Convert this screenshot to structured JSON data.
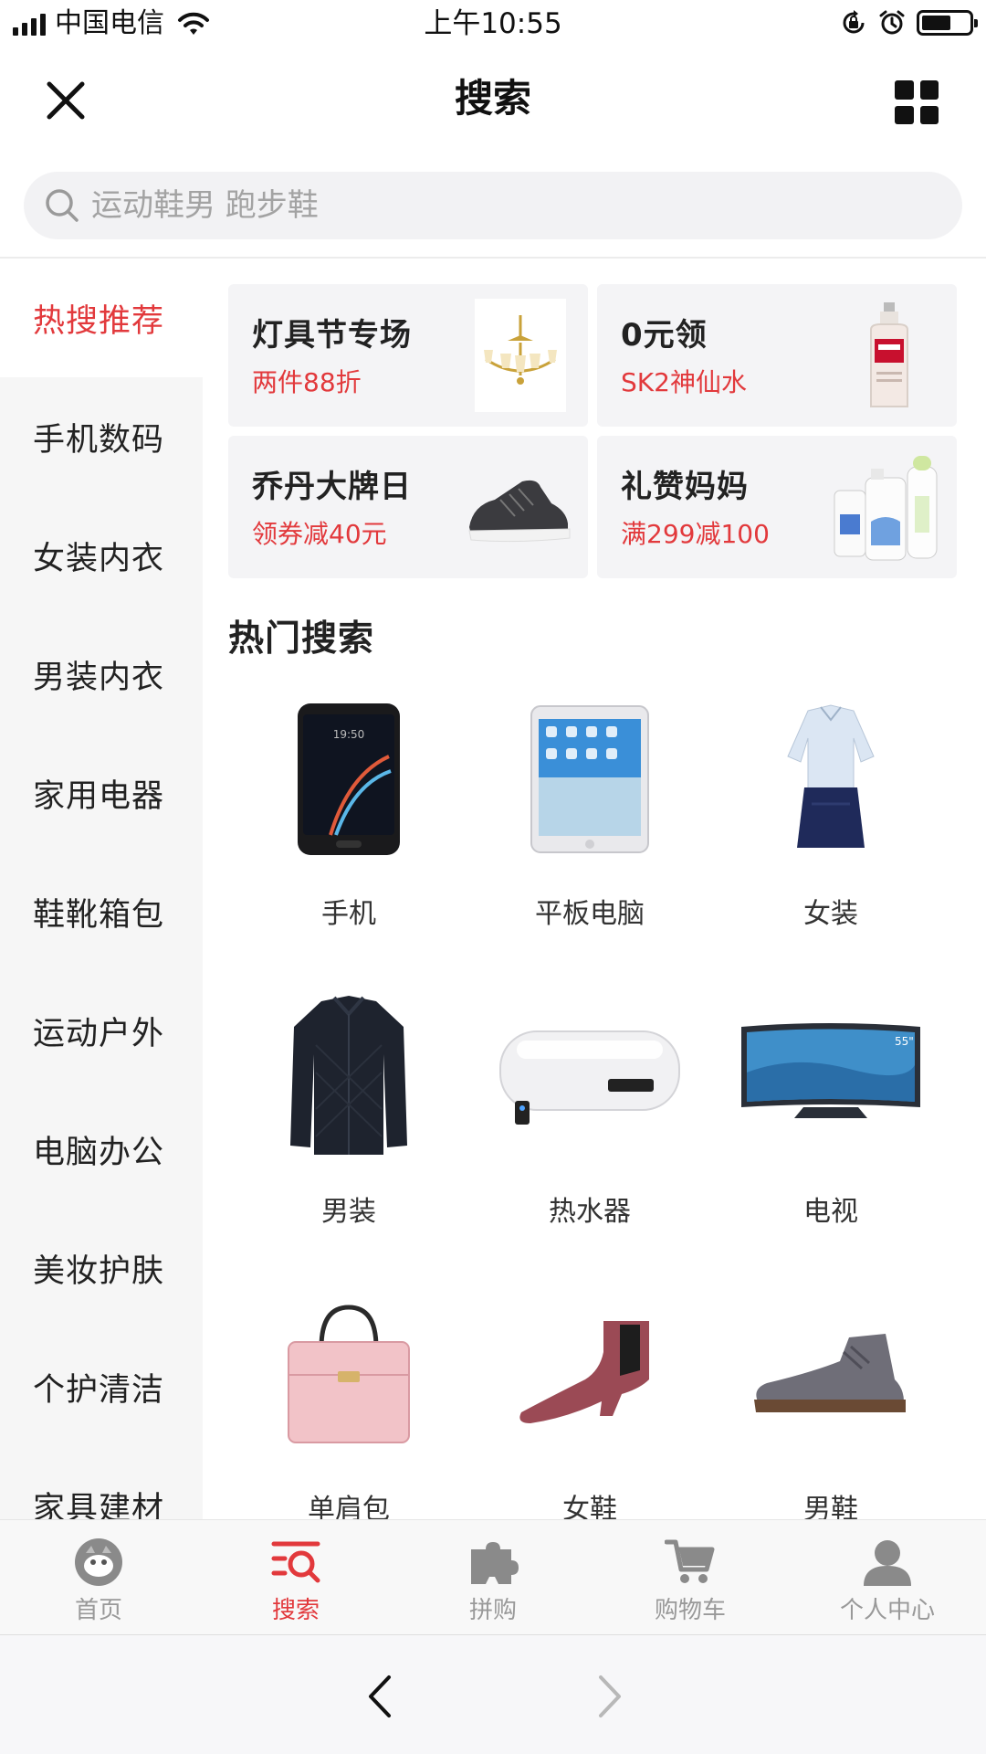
{
  "status_bar": {
    "carrier": "中国电信",
    "time": "上午10:55"
  },
  "nav": {
    "title": "搜索"
  },
  "search": {
    "placeholder": "运动鞋男 跑步鞋"
  },
  "sidebar": {
    "items": [
      {
        "label": "热搜推荐",
        "active": true
      },
      {
        "label": "手机数码"
      },
      {
        "label": "女装内衣"
      },
      {
        "label": "男装内衣"
      },
      {
        "label": "家用电器"
      },
      {
        "label": "鞋靴箱包"
      },
      {
        "label": "运动户外"
      },
      {
        "label": "电脑办公"
      },
      {
        "label": "美妆护肤"
      },
      {
        "label": "个护清洁"
      },
      {
        "label": "家具建材"
      }
    ]
  },
  "promos": [
    {
      "title": "灯具节专场",
      "subtitle": "两件88折",
      "icon": "chandelier-image"
    },
    {
      "title": "0元领",
      "subtitle": "SK2神仙水",
      "icon": "skincare-bottle-image"
    },
    {
      "title": "乔丹大牌日",
      "subtitle": "领券减40元",
      "icon": "sneaker-image"
    },
    {
      "title": "礼赞妈妈",
      "subtitle": "满299减100",
      "icon": "baby-products-image"
    }
  ],
  "hot_search": {
    "title": "热门搜索",
    "items": [
      {
        "label": "手机",
        "icon": "phone-image"
      },
      {
        "label": "平板电脑",
        "icon": "tablet-image"
      },
      {
        "label": "女装",
        "icon": "womens-clothing-image"
      },
      {
        "label": "男装",
        "icon": "jacket-image"
      },
      {
        "label": "热水器",
        "icon": "water-heater-image"
      },
      {
        "label": "电视",
        "icon": "tv-image"
      },
      {
        "label": "单肩包",
        "icon": "handbag-image"
      },
      {
        "label": "女鞋",
        "icon": "womens-boot-image"
      },
      {
        "label": "男鞋",
        "icon": "mens-shoe-image"
      }
    ]
  },
  "tab_bar": {
    "tabs": [
      {
        "label": "首页",
        "icon": "home-mascot-icon"
      },
      {
        "label": "搜索",
        "icon": "search-list-icon",
        "active": true
      },
      {
        "label": "拼购",
        "icon": "puzzle-icon"
      },
      {
        "label": "购物车",
        "icon": "cart-icon"
      },
      {
        "label": "个人中心",
        "icon": "user-icon"
      }
    ]
  },
  "colors": {
    "accent": "#e2393c",
    "sidebar_bg": "#f6f6f6",
    "card_bg": "#f4f4f6"
  }
}
